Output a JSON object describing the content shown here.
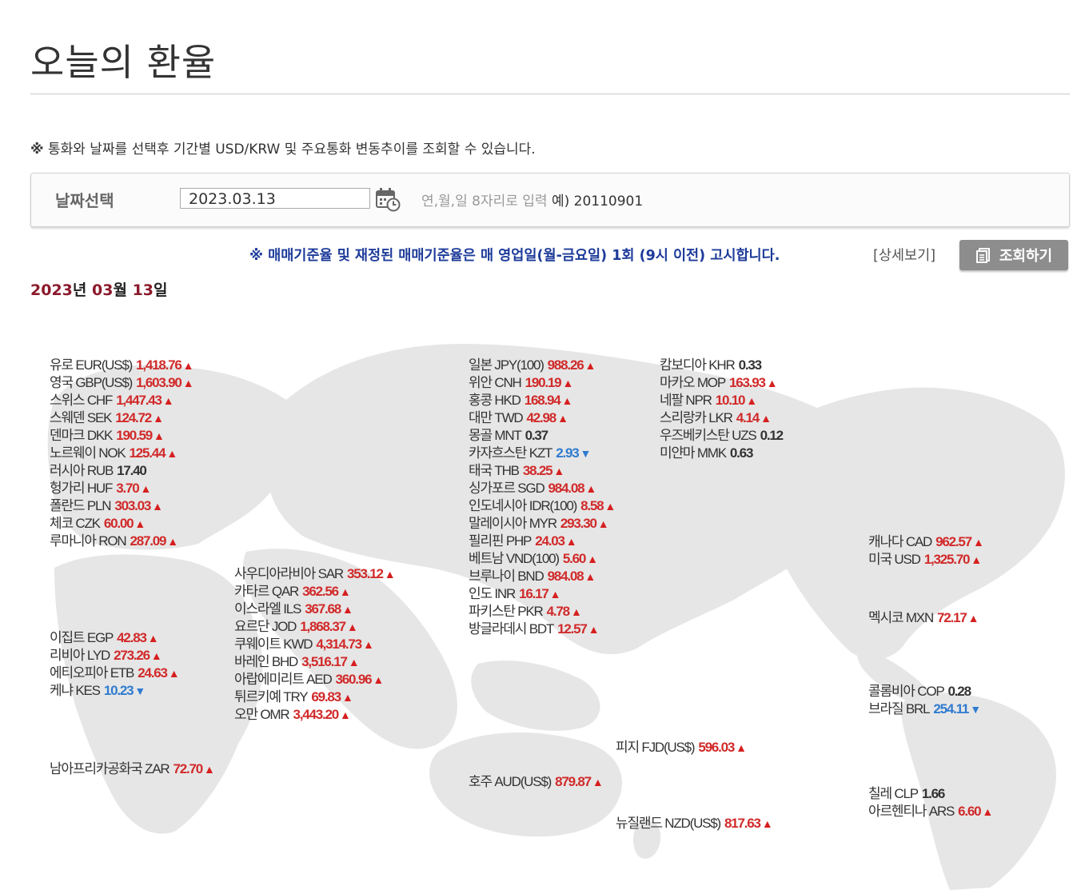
{
  "page": {
    "title": "오늘의 환율",
    "notice_mark": "※",
    "notice": "통화와 날짜를 선택후 기간별 USD/KRW 및 주요통화 변동추이를 조회할 수 있습니다.",
    "search": {
      "label": "날짜선택",
      "date_value": "2023.03.13",
      "hint": "연,월,일 8자리로 입력",
      "example": "예) 20110901"
    },
    "blue_note": "※ 매매기준율 및 재정된 매매기준율은 매 영업일(월-금요일) 1회 (9시 이전) 고시합니다.",
    "detail_link": "[상세보기]",
    "query_button": "조회하기",
    "date_heading": {
      "year": "2023",
      "year_unit": "년",
      "month": "03",
      "month_unit": "월",
      "day": "13",
      "day_unit": "일"
    }
  },
  "colors": {
    "up": "#d12a2a",
    "down": "#2f7bd0",
    "flat": "#333333",
    "date_accent": "#8b1a2b",
    "notice_blue": "#1d3b9a"
  },
  "rates": [
    {
      "label": "유로 EUR(US$)",
      "value": "1,418.76",
      "trend": "up"
    },
    {
      "label": "영국 GBP(US$)",
      "value": "1,603.90",
      "trend": "up"
    },
    {
      "label": "스위스 CHF",
      "value": "1,447.43",
      "trend": "up"
    },
    {
      "label": "스웨덴 SEK",
      "value": "124.72",
      "trend": "up"
    },
    {
      "label": "덴마크 DKK",
      "value": "190.59",
      "trend": "up"
    },
    {
      "label": "노르웨이 NOK",
      "value": "125.44",
      "trend": "up"
    },
    {
      "label": "러시아 RUB",
      "value": "17.40",
      "trend": "flat"
    },
    {
      "label": "헝가리 HUF",
      "value": "3.70",
      "trend": "up"
    },
    {
      "label": "폴란드 PLN",
      "value": "303.03",
      "trend": "up"
    },
    {
      "label": "체코 CZK",
      "value": "60.00",
      "trend": "up"
    },
    {
      "label": "루마니아 RON",
      "value": "287.09",
      "trend": "up"
    },
    {
      "label": "이집트 EGP",
      "value": "42.83",
      "trend": "up"
    },
    {
      "label": "리비아 LYD",
      "value": "273.26",
      "trend": "up"
    },
    {
      "label": "에티오피아 ETB",
      "value": "24.63",
      "trend": "up"
    },
    {
      "label": "케냐 KES",
      "value": "10.23",
      "trend": "down"
    },
    {
      "label": "남아프리카공화국 ZAR",
      "value": "72.70",
      "trend": "up"
    },
    {
      "label": "사우디아라비아 SAR",
      "value": "353.12",
      "trend": "up"
    },
    {
      "label": "카타르 QAR",
      "value": "362.56",
      "trend": "up"
    },
    {
      "label": "이스라엘 ILS",
      "value": "367.68",
      "trend": "up"
    },
    {
      "label": "요르단 JOD",
      "value": "1,868.37",
      "trend": "up"
    },
    {
      "label": "쿠웨이트 KWD",
      "value": "4,314.73",
      "trend": "up"
    },
    {
      "label": "바레인 BHD",
      "value": "3,516.17",
      "trend": "up"
    },
    {
      "label": "아랍에미리트 AED",
      "value": "360.96",
      "trend": "up"
    },
    {
      "label": "튀르키예 TRY",
      "value": "69.83",
      "trend": "up"
    },
    {
      "label": "오만 OMR",
      "value": "3,443.20",
      "trend": "up"
    },
    {
      "label": "일본 JPY(100)",
      "value": "988.26",
      "trend": "up"
    },
    {
      "label": "위안 CNH",
      "value": "190.19",
      "trend": "up"
    },
    {
      "label": "홍콩 HKD",
      "value": "168.94",
      "trend": "up"
    },
    {
      "label": "대만 TWD",
      "value": "42.98",
      "trend": "up"
    },
    {
      "label": "몽골 MNT",
      "value": "0.37",
      "trend": "flat"
    },
    {
      "label": "카자흐스탄 KZT",
      "value": "2.93",
      "trend": "down"
    },
    {
      "label": "태국 THB",
      "value": "38.25",
      "trend": "up"
    },
    {
      "label": "싱가포르 SGD",
      "value": "984.08",
      "trend": "up"
    },
    {
      "label": "인도네시아 IDR(100)",
      "value": "8.58",
      "trend": "up"
    },
    {
      "label": "말레이시아 MYR",
      "value": "293.30",
      "trend": "up"
    },
    {
      "label": "필리핀 PHP",
      "value": "24.03",
      "trend": "up"
    },
    {
      "label": "베트남 VND(100)",
      "value": "5.60",
      "trend": "up"
    },
    {
      "label": "브루나이 BND",
      "value": "984.08",
      "trend": "up"
    },
    {
      "label": "인도 INR",
      "value": "16.17",
      "trend": "up"
    },
    {
      "label": "파키스탄 PKR",
      "value": "4.78",
      "trend": "up"
    },
    {
      "label": "방글라데시 BDT",
      "value": "12.57",
      "trend": "up"
    },
    {
      "label": "호주 AUD(US$)",
      "value": "879.87",
      "trend": "up"
    },
    {
      "label": "캄보디아 KHR",
      "value": "0.33",
      "trend": "flat"
    },
    {
      "label": "마카오 MOP",
      "value": "163.93",
      "trend": "up"
    },
    {
      "label": "네팔 NPR",
      "value": "10.10",
      "trend": "up"
    },
    {
      "label": "스리랑카 LKR",
      "value": "4.14",
      "trend": "up"
    },
    {
      "label": "우즈베키스탄 UZS",
      "value": "0.12",
      "trend": "flat"
    },
    {
      "label": "미얀마 MMK",
      "value": "0.63",
      "trend": "flat"
    },
    {
      "label": "피지 FJD(US$)",
      "value": "596.03",
      "trend": "up"
    },
    {
      "label": "뉴질랜드 NZD(US$)",
      "value": "817.63",
      "trend": "up"
    },
    {
      "label": "캐나다 CAD",
      "value": "962.57",
      "trend": "up"
    },
    {
      "label": "미국 USD",
      "value": "1,325.70",
      "trend": "up"
    },
    {
      "label": "멕시코 MXN",
      "value": "72.17",
      "trend": "up"
    },
    {
      "label": "콜롬비아 COP",
      "value": "0.28",
      "trend": "flat"
    },
    {
      "label": "브라질 BRL",
      "value": "254.11",
      "trend": "down"
    },
    {
      "label": "칠레 CLP",
      "value": "1.66",
      "trend": "flat"
    },
    {
      "label": "아르헨티나 ARS",
      "value": "6.60",
      "trend": "up"
    }
  ]
}
